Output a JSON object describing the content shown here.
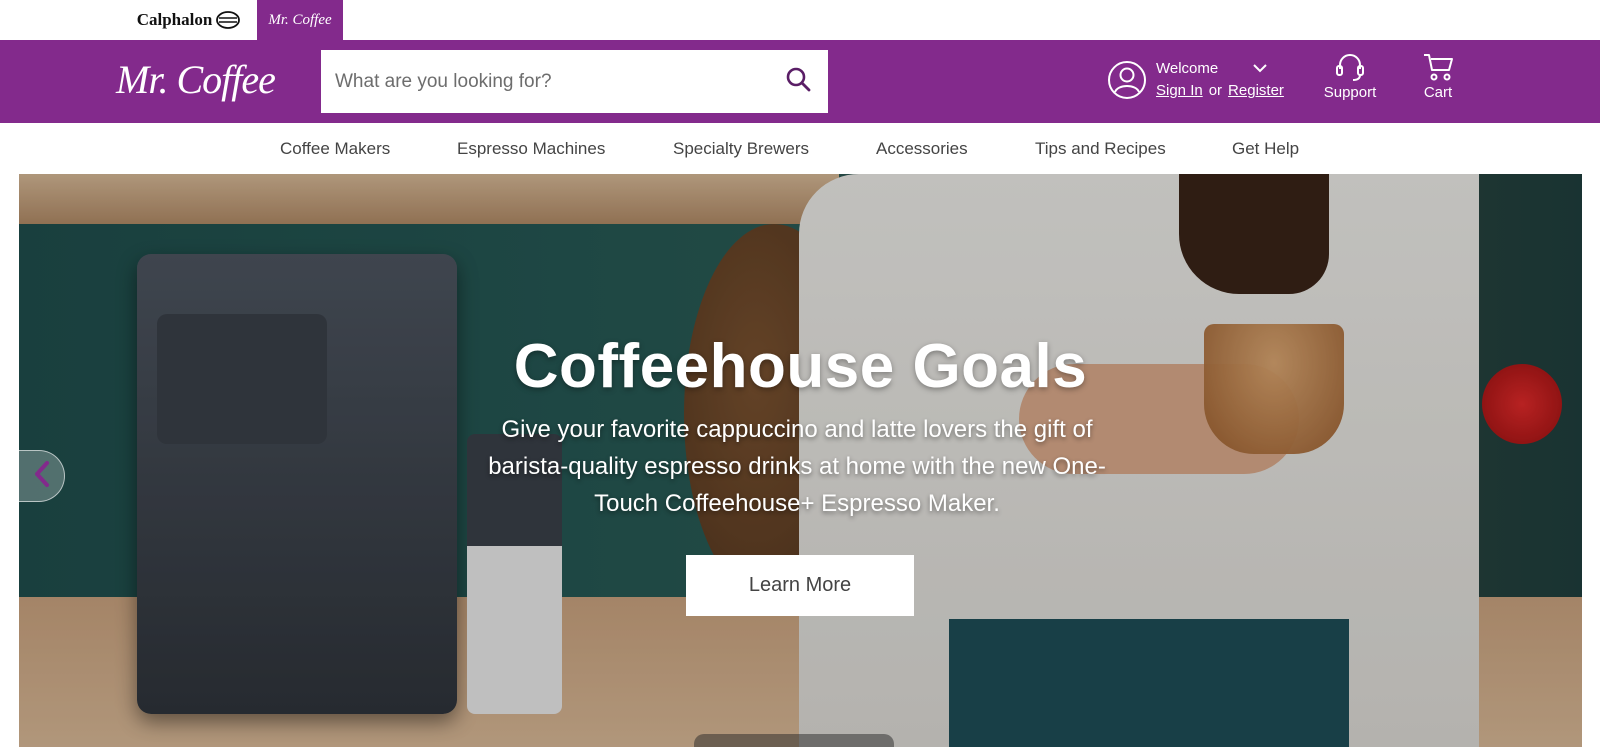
{
  "brands": {
    "calphalon": "Calphalon",
    "mrcoffee": "Mr. Coffee"
  },
  "header": {
    "logo": "Mr. Coffee",
    "search_placeholder": "What are you looking for?",
    "welcome": "Welcome",
    "sign_in": "Sign In",
    "or": "or",
    "register": "Register",
    "support": "Support",
    "cart": "Cart"
  },
  "nav": {
    "items": [
      "Coffee Makers",
      "Espresso Machines",
      "Specialty Brewers",
      "Accessories",
      "Tips and Recipes",
      "Get Help"
    ]
  },
  "hero": {
    "title": "Coffeehouse Goals",
    "text": "Give your favorite cappuccino and latte lovers the gift of barista-quality espresso drinks at home with the new One-Touch Coffeehouse+ Espresso Maker.",
    "button": "Learn More"
  },
  "colors": {
    "brand_purple": "#832a8c",
    "white": "#ffffff"
  },
  "icons": [
    "calphalon-logo-icon",
    "search-icon",
    "user-avatar-icon",
    "chevron-down-icon",
    "headset-icon",
    "cart-icon",
    "chevron-left-icon"
  ]
}
